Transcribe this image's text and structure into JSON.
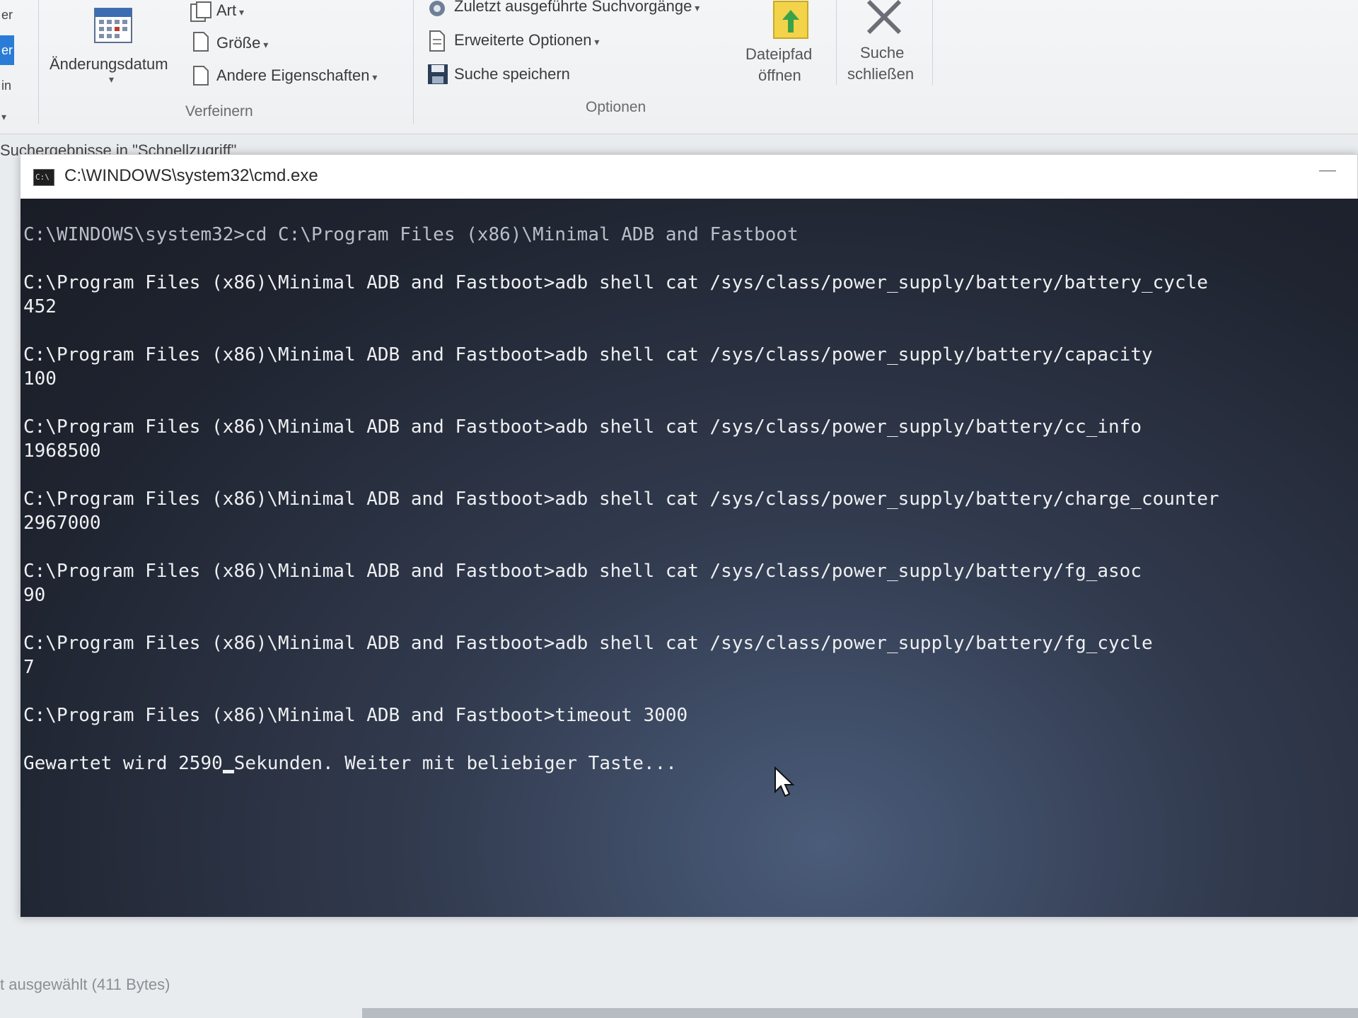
{
  "ribbon": {
    "left_stub_top": "er",
    "left_stub_mid": "er",
    "left_stub_bottom": "in",
    "date_button": "Änderungsdatum",
    "art": "Art",
    "groesse": "Größe",
    "andere": "Andere Eigenschaften",
    "group_refine": "Verfeinern",
    "recent_searches": "Zuletzt ausgeführte Suchvorgänge",
    "advanced_options": "Erweiterte Optionen",
    "save_search": "Suche speichern",
    "group_options": "Optionen",
    "open_path_line1": "Dateipfad",
    "open_path_line2": "öffnen",
    "close_search_line1": "Suche",
    "close_search_line2": "schließen"
  },
  "breadcrumb": "Suchergebnisse in \"Schnellzugriff\"",
  "cmd": {
    "title": "C:\\WINDOWS\\system32\\cmd.exe",
    "icon_text": "C:\\",
    "lines": [
      {
        "text": "C:\\WINDOWS\\system32>cd C:\\Program Files (x86)\\Minimal ADB and Fastboot",
        "dim": true
      },
      {
        "text": ""
      },
      {
        "text": "C:\\Program Files (x86)\\Minimal ADB and Fastboot>adb shell cat /sys/class/power_supply/battery/battery_cycle"
      },
      {
        "text": "452"
      },
      {
        "text": ""
      },
      {
        "text": "C:\\Program Files (x86)\\Minimal ADB and Fastboot>adb shell cat /sys/class/power_supply/battery/capacity"
      },
      {
        "text": "100"
      },
      {
        "text": ""
      },
      {
        "text": "C:\\Program Files (x86)\\Minimal ADB and Fastboot>adb shell cat /sys/class/power_supply/battery/cc_info"
      },
      {
        "text": "1968500"
      },
      {
        "text": ""
      },
      {
        "text": "C:\\Program Files (x86)\\Minimal ADB and Fastboot>adb shell cat /sys/class/power_supply/battery/charge_counter"
      },
      {
        "text": "2967000"
      },
      {
        "text": ""
      },
      {
        "text": "C:\\Program Files (x86)\\Minimal ADB and Fastboot>adb shell cat /sys/class/power_supply/battery/fg_asoc"
      },
      {
        "text": "90"
      },
      {
        "text": ""
      },
      {
        "text": "C:\\Program Files (x86)\\Minimal ADB and Fastboot>adb shell cat /sys/class/power_supply/battery/fg_cycle"
      },
      {
        "text": "7"
      },
      {
        "text": ""
      },
      {
        "text": "C:\\Program Files (x86)\\Minimal ADB and Fastboot>timeout 3000"
      },
      {
        "text": ""
      }
    ],
    "wait_before": "Gewartet wird 2590",
    "wait_after": "Sekunden. Weiter mit beliebiger Taste..."
  },
  "status": {
    "selection": "t ausgewählt (411 Bytes)"
  },
  "icons": {
    "calendar": "calendar-icon",
    "art": "file-type-icon",
    "groesse": "file-size-icon",
    "andere": "properties-icon",
    "recent": "recent-searches-icon",
    "advanced": "advanced-options-icon",
    "save": "save-disk-icon",
    "open_path": "folder-arrow-icon",
    "close": "close-x-icon",
    "cmd": "cmd-console-icon",
    "pointer": "mouse-pointer-icon"
  },
  "colors": {
    "console_bg": "#1f2430",
    "console_text": "#eef0f2",
    "accent_blue": "#2a7cd6"
  }
}
